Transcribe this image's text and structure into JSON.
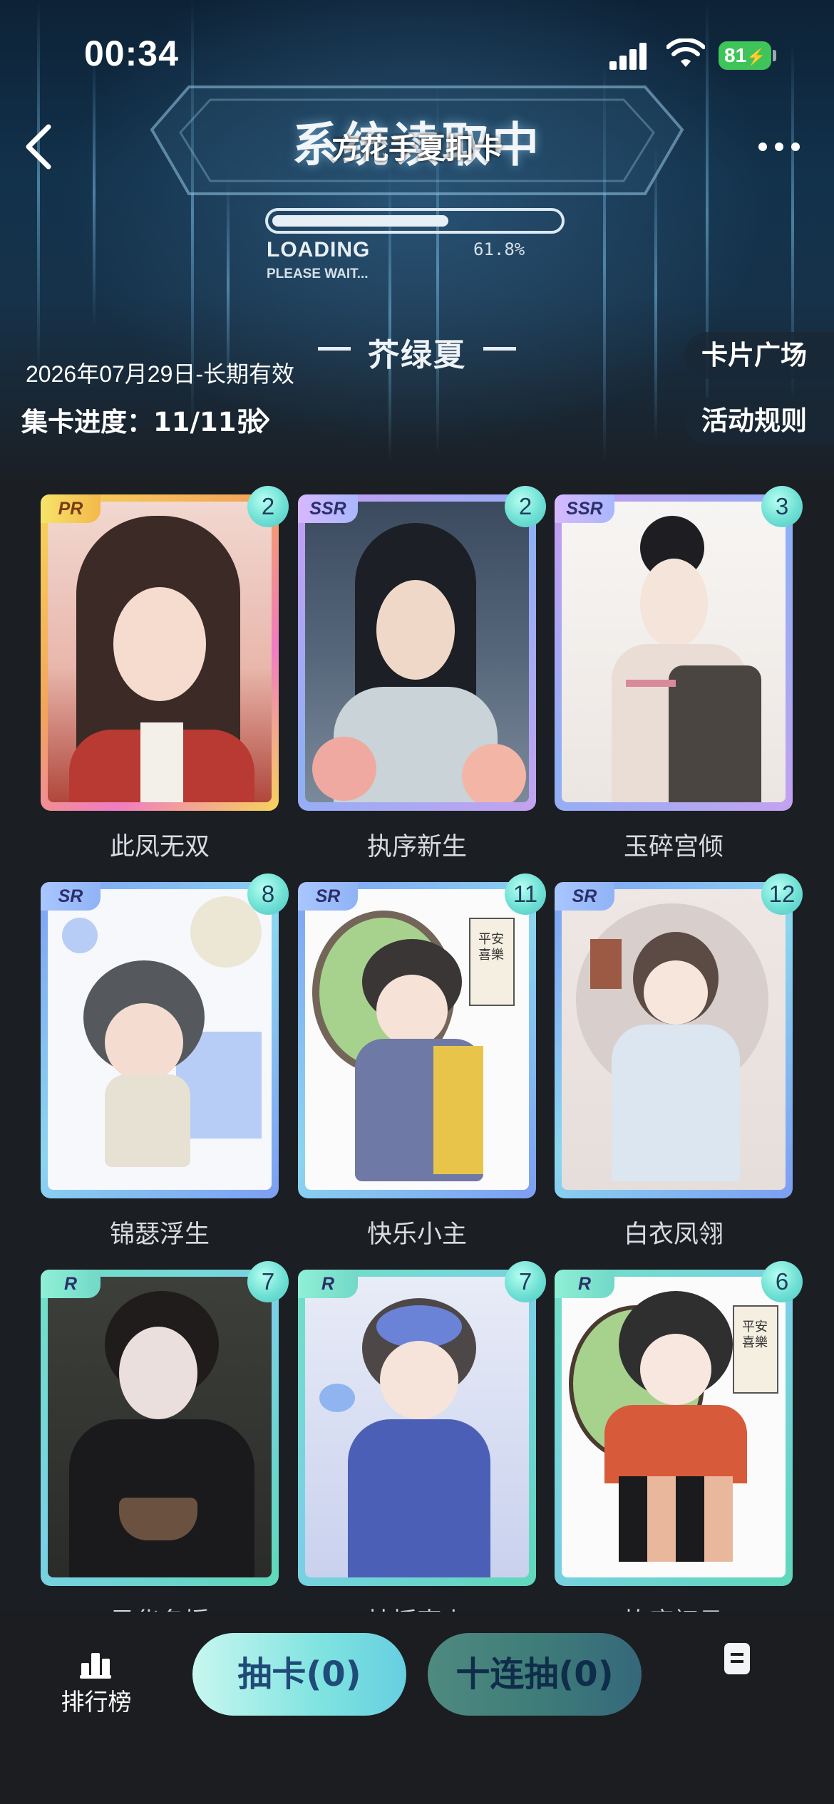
{
  "status_bar": {
    "time": "00:34",
    "battery": "81"
  },
  "header": {
    "hero_title": "系统读取中",
    "page_title": "方花手夏扣卡",
    "loading_label": "LOADING",
    "loading_sub": "PLEASE WAIT...",
    "loading_percent": "61.8%",
    "loading_progress": 0.618
  },
  "collection": {
    "name": "芥绿夏",
    "validity": "2026年07月29日-长期有效",
    "progress_label": "集卡进度：11/11张",
    "square_button": "卡片广场",
    "rules_button": "活动规则"
  },
  "cards": [
    {
      "name": "此凤无双",
      "rarity": "PR",
      "count": "2"
    },
    {
      "name": "执序新生",
      "rarity": "SSR",
      "count": "2"
    },
    {
      "name": "玉碎宫倾",
      "rarity": "SSR",
      "count": "3"
    },
    {
      "name": "锦瑟浮生",
      "rarity": "SR",
      "count": "8"
    },
    {
      "name": "快乐小主",
      "rarity": "SR",
      "count": "11"
    },
    {
      "name": "白衣凤翎",
      "rarity": "SR",
      "count": "12"
    },
    {
      "name": "风华名媛",
      "rarity": "R",
      "count": "7"
    },
    {
      "name": "扶摇直上",
      "rarity": "R",
      "count": "7"
    },
    {
      "name": "拣庭初见",
      "rarity": "R",
      "count": "6"
    }
  ],
  "artwork": {
    "left_banner": "平安喜樂",
    "right_banner": "平安喜樂"
  },
  "bottom_bar": {
    "ranking_label": "排行榜",
    "draw_button": "抽卡(0)",
    "draw_ten_button": "十连抽(0)"
  },
  "colors": {
    "pr_frame": "#f5c84a",
    "ssr_frame": "#b79cf0",
    "sr_frame": "#7fb6f2",
    "r_frame": "#67dcc0",
    "count_badge": "#6fe0d4"
  },
  "icons": [
    "back-icon",
    "more-icon",
    "chevron-right-icon",
    "ranking-icon",
    "document-icon",
    "signal-icon",
    "wifi-icon",
    "battery-icon"
  ]
}
